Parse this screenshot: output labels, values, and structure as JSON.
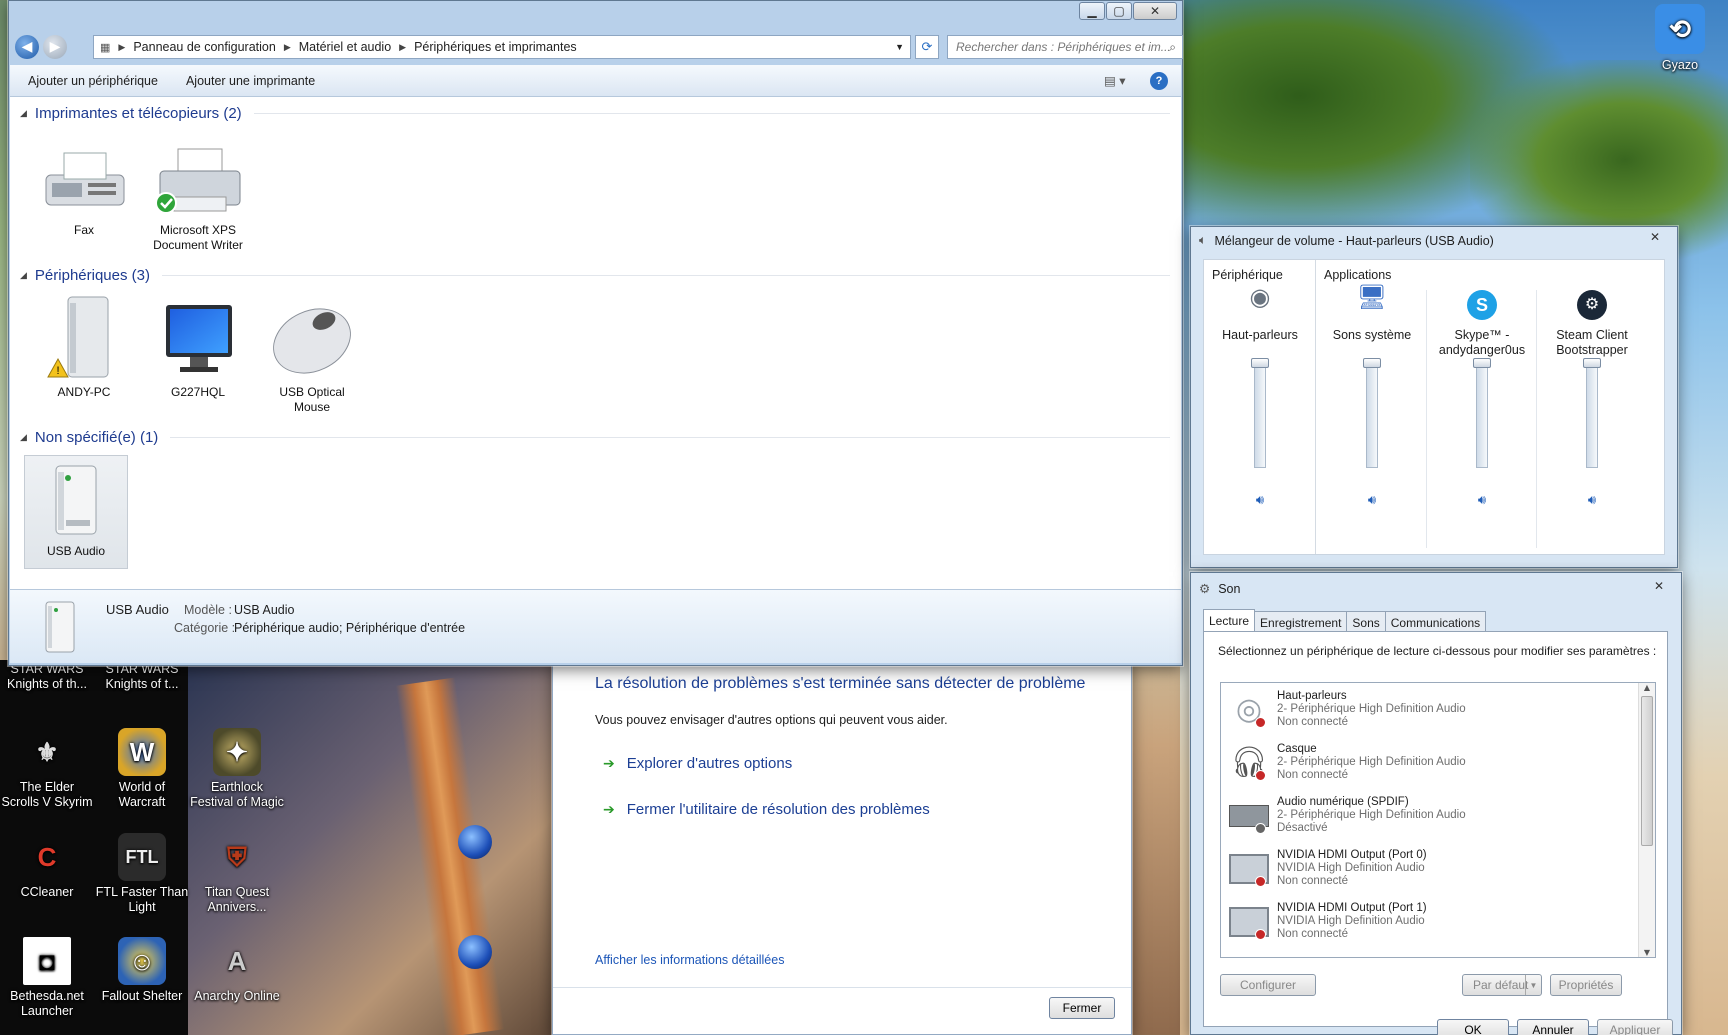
{
  "explorer": {
    "address": [
      "Panneau de configuration",
      "Matériel et audio",
      "Périphériques et imprimantes"
    ],
    "search_placeholder": "Rechercher dans : Périphériques et im...",
    "commands": {
      "add_device": "Ajouter un périphérique",
      "add_printer": "Ajouter une imprimante"
    },
    "groups": [
      {
        "title": "Imprimantes et télécopieurs (2)",
        "items": [
          "Fax",
          "Microsoft XPS Document Writer"
        ]
      },
      {
        "title": "Périphériques (3)",
        "items": [
          "ANDY-PC",
          "G227HQL",
          "USB Optical Mouse"
        ]
      },
      {
        "title": "Non spécifié(e) (1)",
        "items": [
          "USB Audio"
        ]
      }
    ],
    "details": {
      "name": "USB Audio",
      "model_label": "Modèle :",
      "model_value": "USB Audio",
      "category_label": "Catégorie :",
      "category_value": "Périphérique audio; Périphérique d'entrée"
    }
  },
  "desktop_icons": [
    {
      "label": "STAR WARS Knights of th...",
      "icon": "star-wars-icon"
    },
    {
      "label": "STAR WARS Knights of t...",
      "icon": "star-wars-icon"
    },
    {
      "label": "The Elder Scrolls V Skyrim",
      "icon": "skyrim-icon"
    },
    {
      "label": "World of Warcraft",
      "icon": "wow-icon"
    },
    {
      "label": "Earthlock Festival of Magic",
      "icon": "earthlock-icon"
    },
    {
      "label": "CCleaner",
      "icon": "ccleaner-icon"
    },
    {
      "label": "FTL Faster Than Light",
      "icon": "ftl-icon"
    },
    {
      "label": "Titan Quest Annivers...",
      "icon": "titan-quest-icon"
    },
    {
      "label": "Bethesda.net Launcher",
      "icon": "bethesda-icon"
    },
    {
      "label": "Fallout Shelter",
      "icon": "fallout-shelter-icon"
    },
    {
      "label": "Anarchy Online",
      "icon": "anarchy-online-icon"
    },
    {
      "label": "Gyazo",
      "icon": "gyazo-icon"
    }
  ],
  "troubleshooter": {
    "title": "La résolution de problèmes s'est terminée sans détecter de problème",
    "subtitle": "Vous pouvez envisager d'autres options qui peuvent vous aider.",
    "option1": "Explorer d'autres options",
    "option2": "Fermer l'utilitaire de résolution des problèmes",
    "details_link": "Afficher les informations détaillées",
    "close_button": "Fermer"
  },
  "mixer": {
    "title": "Mélangeur de volume - Haut-parleurs (USB Audio)",
    "device_header": "Périphérique",
    "apps_header": "Applications",
    "channels": [
      {
        "name": "Haut-parleurs",
        "level": 1.0
      },
      {
        "name": "Sons système",
        "level": 1.0
      },
      {
        "name": "Skype™ - andydanger0us",
        "level": 1.0
      },
      {
        "name": "Steam Client Bootstrapper",
        "level": 1.0
      }
    ]
  },
  "son": {
    "title": "Son",
    "tabs": [
      "Lecture",
      "Enregistrement",
      "Sons",
      "Communications"
    ],
    "instruction": "Sélectionnez un périphérique de lecture ci-dessous pour modifier ses paramètres :",
    "devices": [
      {
        "name": "Haut-parleurs",
        "driver": "2- Périphérique High Definition Audio",
        "status": "Non connecté"
      },
      {
        "name": "Casque",
        "driver": "2- Périphérique High Definition Audio",
        "status": "Non connecté"
      },
      {
        "name": "Audio numérique (SPDIF)",
        "driver": "2- Périphérique High Definition Audio",
        "status": "Désactivé"
      },
      {
        "name": "NVIDIA HDMI Output (Port 0)",
        "driver": "NVIDIA High Definition Audio",
        "status": "Non connecté"
      },
      {
        "name": "NVIDIA HDMI Output (Port 1)",
        "driver": "NVIDIA High Definition Audio",
        "status": "Non connecté"
      }
    ],
    "buttons": {
      "configure": "Configurer",
      "default": "Par défaut",
      "properties": "Propriétés",
      "ok": "OK",
      "cancel": "Annuler",
      "apply": "Appliquer"
    }
  }
}
